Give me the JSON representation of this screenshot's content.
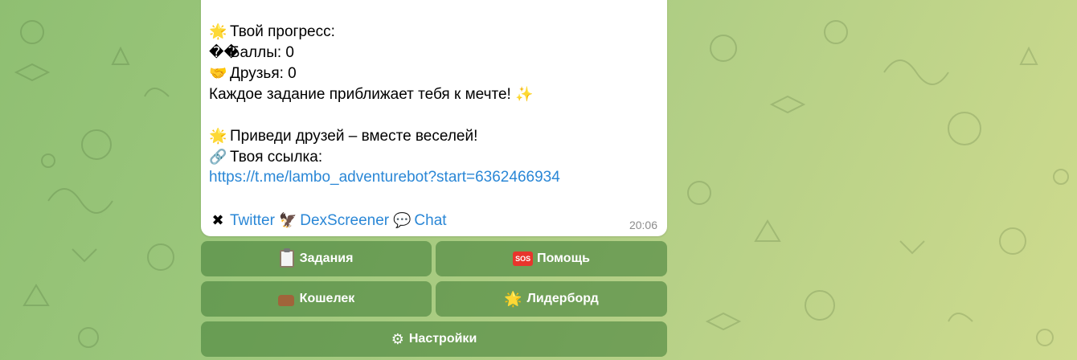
{
  "message": {
    "lines": [
      {
        "icon": "🌟",
        "text": "Твой прогресс:"
      },
      {
        "icon": "��",
        "text": "Баллы: 0"
      },
      {
        "icon": "🤝",
        "text": "Друзья: 0"
      },
      {
        "icon": "",
        "text": "Каждое задание приближает тебя к мечте!",
        "trail_icon": "✨"
      },
      {
        "icon": "🌟",
        "text": "Приведи друзей – вместе веселей!"
      },
      {
        "icon": "🔗",
        "text": "Твоя ссылка:"
      }
    ],
    "link": "https://t.me/lambo_adventurebot?start=6362466934",
    "socials": {
      "twitter_icon": "✖",
      "twitter": "Twitter",
      "dex_icon": "🦅",
      "dexscreener": "DexScreener",
      "chat_icon": "💬",
      "chat": "Chat"
    },
    "time": "20:06"
  },
  "keyboard": {
    "tasks": "Задания",
    "help_icon": "SOS",
    "help": "Помощь",
    "wallet": "Кошелек",
    "leaderboard_icon": "🌟",
    "leaderboard": "Лидерборд",
    "settings_icon": "⚙",
    "settings": "Настройки"
  },
  "colors": {
    "link": "#2a87d6",
    "button_bg": "rgba(72,130,60,0.62)",
    "wallpaper_from": "#8fbf72",
    "wallpaper_to": "#cfdb8e"
  }
}
